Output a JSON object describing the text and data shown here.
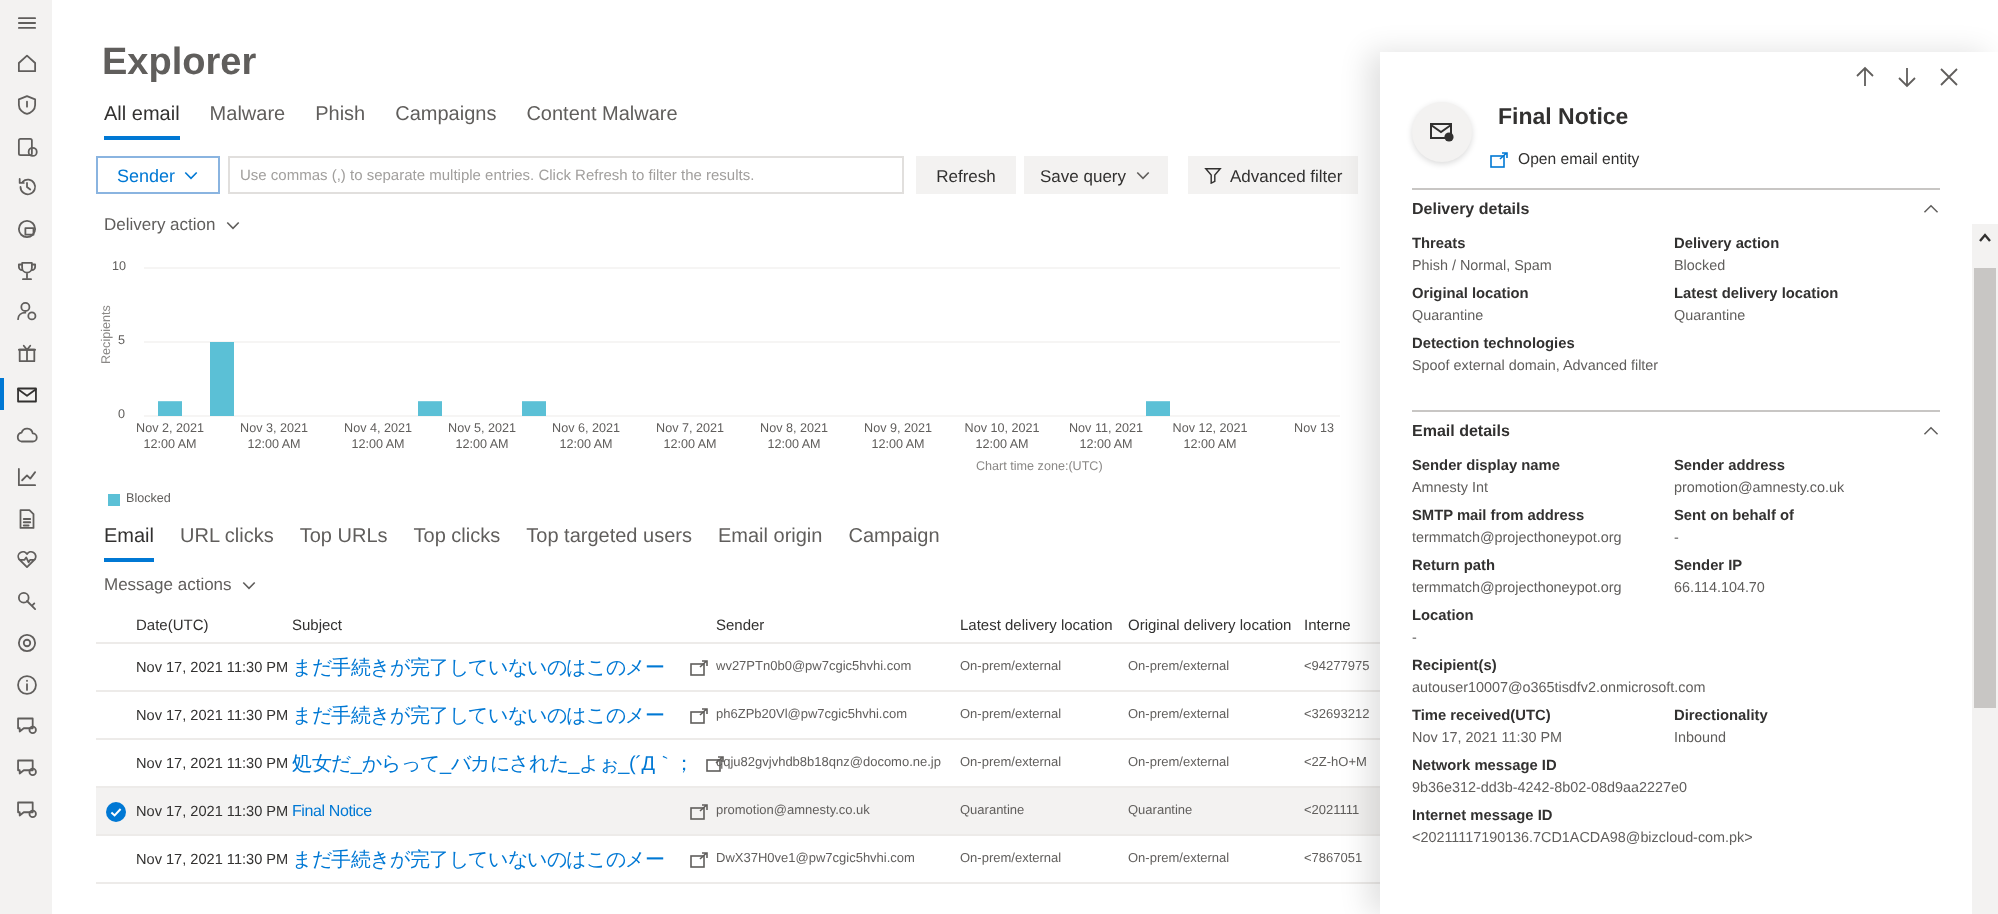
{
  "sidebar": {
    "items": [
      {
        "selected": false
      },
      {
        "selected": false
      },
      {
        "selected": false
      },
      {
        "selected": false
      },
      {
        "selected": false
      },
      {
        "selected": false
      },
      {
        "selected": false
      },
      {
        "selected": false
      },
      {
        "selected": false
      },
      {
        "selected": true
      },
      {
        "selected": false
      },
      {
        "selected": false
      },
      {
        "selected": false
      },
      {
        "selected": false
      },
      {
        "selected": false
      },
      {
        "selected": false
      },
      {
        "selected": false
      },
      {
        "selected": false
      },
      {
        "selected": false
      },
      {
        "selected": false
      }
    ]
  },
  "page": {
    "title": "Explorer"
  },
  "tabs": [
    {
      "label": "All email",
      "selected": true
    },
    {
      "label": "Malware",
      "selected": false
    },
    {
      "label": "Phish",
      "selected": false
    },
    {
      "label": "Campaigns",
      "selected": false
    },
    {
      "label": "Content Malware",
      "selected": false
    }
  ],
  "filter": {
    "field_selector": "Sender",
    "placeholder": "Use commas (,) to separate multiple entries. Click Refresh to filter the results.",
    "refresh": "Refresh",
    "save_query": "Save query",
    "advanced_filter": "Advanced filter"
  },
  "view_selector": "Delivery action",
  "chart": {
    "chart_data": {
      "type": "bar",
      "ylabel": "Recipients",
      "xlabel": "Chart time zone:(UTC)",
      "ylim": [
        0,
        10
      ],
      "yticks": [
        0,
        5,
        10
      ],
      "categories": [
        "Nov 2, 2021 12:00 AM",
        null,
        "Nov 3, 2021 12:00 AM",
        null,
        "Nov 4, 2021 12:00 AM",
        null,
        "Nov 5, 2021 12:00 AM",
        null,
        "Nov 6, 2021 12:00 AM",
        null,
        "Nov 7, 2021 12:00 AM",
        null,
        "Nov 8, 2021 12:00 AM",
        null,
        "Nov 9, 2021 12:00 AM",
        null,
        "Nov 10, 2021 12:00 AM",
        null,
        "Nov 11, 2021 12:00 AM",
        null,
        "Nov 12, 2021 12:00 AM",
        null,
        "Nov 13"
      ],
      "series": [
        {
          "name": "Blocked",
          "color": "#5bc0d6",
          "values": [
            1,
            5,
            null,
            null,
            null,
            1,
            null,
            1,
            null,
            null,
            null,
            null,
            null,
            null,
            null,
            null,
            null,
            null,
            null,
            1,
            null,
            null,
            null
          ]
        }
      ]
    }
  },
  "detail_tabs": [
    {
      "label": "Email",
      "selected": true
    },
    {
      "label": "URL clicks",
      "selected": false
    },
    {
      "label": "Top URLs",
      "selected": false
    },
    {
      "label": "Top clicks",
      "selected": false
    },
    {
      "label": "Top targeted users",
      "selected": false
    },
    {
      "label": "Email origin",
      "selected": false
    },
    {
      "label": "Campaign",
      "selected": false
    }
  ],
  "message_actions": "Message actions",
  "table": {
    "columns": [
      "Date(UTC)",
      "Subject",
      "Sender",
      "Latest delivery location",
      "Original delivery location",
      "Interne"
    ],
    "rows": [
      {
        "selected": false,
        "cells": [
          "Nov 17, 2021 11:30 PM",
          "まだ手続きが完了していないのはこのメー",
          "wv27PTn0b0@pw7cgic5hvhi.com",
          "On-prem/external",
          "On-prem/external",
          "<94277975"
        ]
      },
      {
        "selected": false,
        "cells": [
          "Nov 17, 2021 11:30 PM",
          "まだ手続きが完了していないのはこのメー",
          "ph6ZPb20Vl@pw7cgic5hvhi.com",
          "On-prem/external",
          "On-prem/external",
          "<32693212"
        ]
      },
      {
        "selected": false,
        "cells": [
          "Nov 17, 2021 11:30 PM",
          "処女だ_からって_バカにされた_よぉ_(´Д｀；",
          "qqju82gvjvhdb8b18qnz@docomo.ne.jp",
          "On-prem/external",
          "On-prem/external",
          "<2Z-hO+M"
        ]
      },
      {
        "selected": true,
        "cells": [
          "Nov 17, 2021 11:30 PM",
          "Final Notice",
          "promotion@amnesty.co.uk",
          "Quarantine",
          "Quarantine",
          "<2021111"
        ]
      },
      {
        "selected": false,
        "cells": [
          "Nov 17, 2021 11:30 PM",
          "まだ手続きが完了していないのはこのメー",
          "DwX37H0ve1@pw7cgic5hvhi.com",
          "On-prem/external",
          "On-prem/external",
          "<7867051"
        ]
      }
    ]
  },
  "panel": {
    "title": "Final Notice",
    "link": "Open email entity",
    "sections": [
      {
        "title": "Delivery details",
        "expanded": true,
        "rows": [
          [
            {
              "label": "Threats",
              "value": "Phish / Normal, Spam"
            },
            {
              "label": "Delivery action",
              "value": "Blocked"
            }
          ],
          [
            {
              "label": "Original location",
              "value": "Quarantine"
            },
            {
              "label": "Latest delivery location",
              "value": "Quarantine"
            }
          ],
          [
            {
              "label": "Detection technologies",
              "value": "Spoof external domain, Advanced filter"
            }
          ]
        ]
      },
      {
        "title": "Email details",
        "expanded": true,
        "rows": [
          [
            {
              "label": "Sender display name",
              "value": "Amnesty Int"
            },
            {
              "label": "Sender address",
              "value": "promotion@amnesty.co.uk"
            }
          ],
          [
            {
              "label": "SMTP mail from address",
              "value": "termmatch@projecthoneypot.org"
            },
            {
              "label": "Sent on behalf of",
              "value": "-"
            }
          ],
          [
            {
              "label": "Return path",
              "value": "termmatch@projecthoneypot.org"
            },
            {
              "label": "Sender IP",
              "value": "66.114.104.70"
            }
          ],
          [
            {
              "label": "Location",
              "value": "-"
            }
          ],
          [
            {
              "label": "Recipient(s)",
              "value": "autouser10007@o365tisdfv2.onmicrosoft.com"
            }
          ],
          [
            {
              "label": "Time received(UTC)",
              "value": "Nov 17, 2021 11:30 PM"
            },
            {
              "label": "Directionality",
              "value": "Inbound"
            }
          ],
          [
            {
              "label": "Network message ID",
              "value": "9b36e312-dd3b-4242-8b02-08d9aa2227e0"
            }
          ],
          [
            {
              "label": "Internet message ID",
              "value": "<20211117190136.7CD1ACDA98@bizcloud-com.pk>"
            }
          ]
        ]
      }
    ]
  }
}
